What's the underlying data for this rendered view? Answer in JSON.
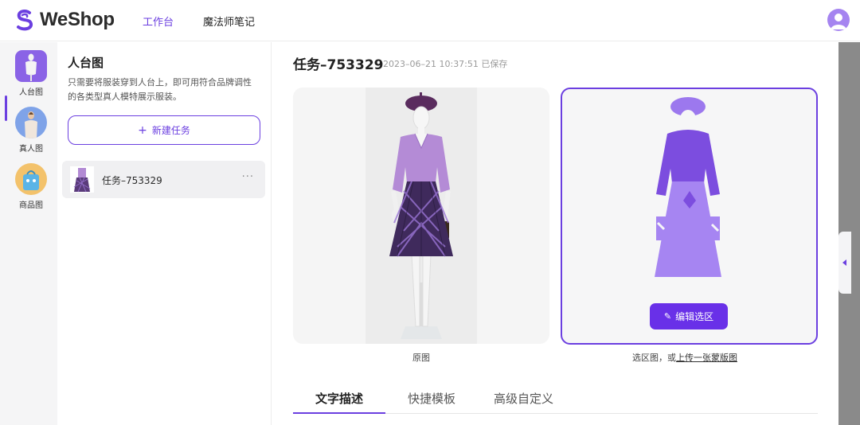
{
  "header": {
    "brand": "WeShop",
    "nav": {
      "workbench": "工作台",
      "notes": "魔法师笔记"
    }
  },
  "rail": {
    "items": [
      {
        "label": "人台图",
        "active": true
      },
      {
        "label": "真人图",
        "active": false
      },
      {
        "label": "商品图",
        "active": false
      }
    ]
  },
  "panel": {
    "title": "人台图",
    "description": "只需要将服装穿到人台上，即可用符合品牌调性的各类型真人模特展示服装。",
    "new_task": {
      "icon": "plus-icon",
      "label": "新建任务"
    },
    "tasks": [
      {
        "name": "任务–753329",
        "more": "···"
      }
    ]
  },
  "main": {
    "task_title": "任务–753329",
    "task_meta": "2023–06–21 10:37:51 已保存",
    "original_caption": "原图",
    "selection_caption": {
      "prefix": "选区图，或",
      "link": "上传一张蒙版图"
    },
    "edit_button": {
      "icon": "pencil-icon",
      "label": "编辑选区"
    },
    "tabs": [
      {
        "label": "文字描述",
        "active": true
      },
      {
        "label": "快捷模板",
        "active": false
      },
      {
        "label": "高级自定义",
        "active": false
      }
    ]
  },
  "colors": {
    "accent": "#6b3fe0",
    "button": "#6930e8",
    "mask": "#a07ef2",
    "blouse": "#b28ad4",
    "skirt": "#5a3b7a"
  }
}
